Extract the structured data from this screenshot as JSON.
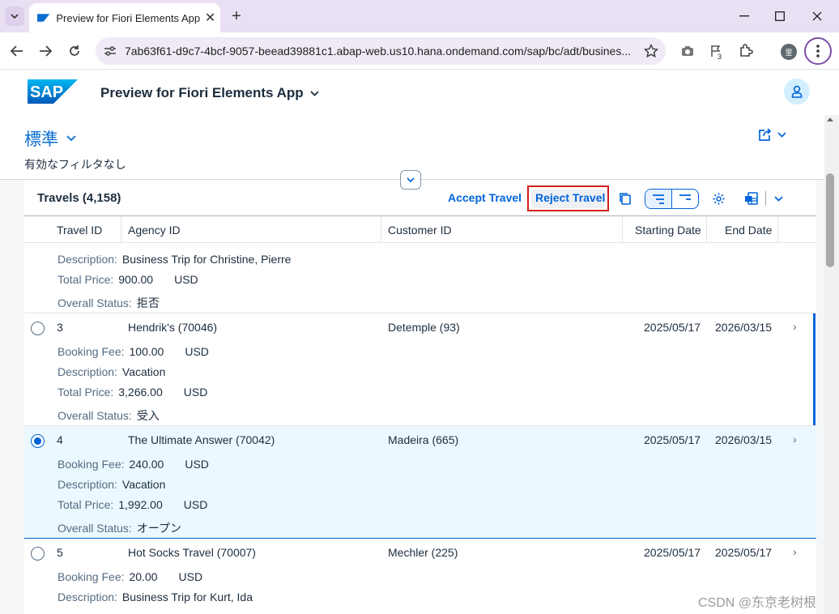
{
  "browser": {
    "tab_title": "Preview for Fiori Elements App",
    "url": "7ab63f61-d9c7-4bcf-9057-beead39881c1.abap-web.us10.hana.ondemand.com/sap/bc/adt/busines...",
    "extension_badge": "3",
    "profile_initial": "里"
  },
  "shell": {
    "logo_text": "SAP",
    "app_title": "Preview for Fiori Elements App"
  },
  "header": {
    "variant": "標準",
    "filter_text": "有効なフィルタなし"
  },
  "table": {
    "title": "Travels (4,158)",
    "accept_label": "Accept Travel",
    "reject_label": "Reject Travel",
    "columns": [
      "Travel ID",
      "Agency ID",
      "Customer ID",
      "Starting Date",
      "End Date"
    ],
    "labels": {
      "booking_fee": "Booking Fee:",
      "description": "Description:",
      "total_price": "Total Price:",
      "overall_status": "Overall Status:"
    },
    "row0": {
      "description": "Business Trip for Christine, Pierre",
      "total_price": "900.00",
      "currency": "USD",
      "status": "拒否"
    },
    "row1": {
      "id": "3",
      "agency": "Hendrik's (70046)",
      "customer": "Detemple (93)",
      "start": "2025/05/17",
      "end": "2026/03/15",
      "booking_fee": "100.00",
      "currency": "USD",
      "description": "Vacation",
      "total_price": "3,266.00",
      "status": "受入"
    },
    "row2": {
      "id": "4",
      "agency": "The Ultimate Answer (70042)",
      "customer": "Madeira (665)",
      "start": "2025/05/17",
      "end": "2026/03/15",
      "booking_fee": "240.00",
      "currency": "USD",
      "description": "Vacation",
      "total_price": "1,992.00",
      "status": "オープン"
    },
    "row3": {
      "id": "5",
      "agency": "Hot Socks Travel (70007)",
      "customer": "Mechler (225)",
      "start": "2025/05/17",
      "end": "2025/05/17",
      "booking_fee": "20.00",
      "currency": "USD",
      "description": "Business Trip for Kurt, Ida"
    }
  },
  "watermark": "CSDN @东京老树根",
  "colors": {
    "accent": "#0064d9",
    "selected_row": "#ebf8ff",
    "highlight": "#d71c1c"
  }
}
